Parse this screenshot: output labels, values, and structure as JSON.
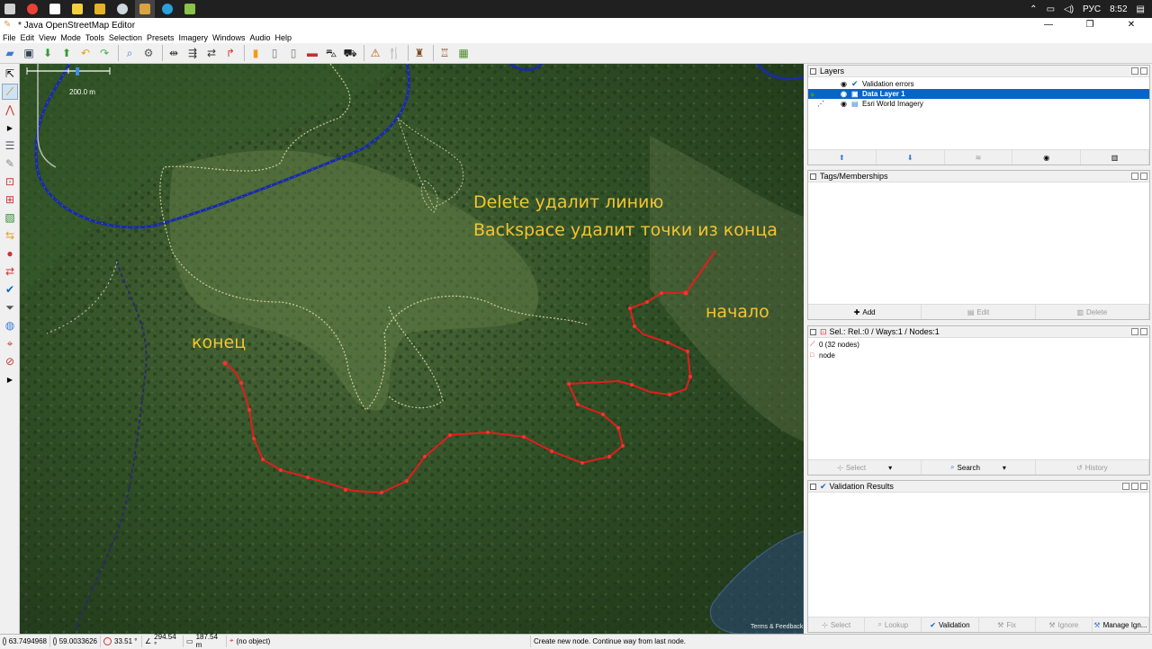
{
  "taskbar": {
    "apps": [
      {
        "icon": "task-view-icon",
        "color": "#e0e0e0"
      },
      {
        "icon": "chrome-icon",
        "color": "#e94235"
      },
      {
        "icon": "file-icon",
        "color": "#ffffff"
      },
      {
        "icon": "notes-icon",
        "color": "#f4d03f"
      },
      {
        "icon": "folder-icon",
        "color": "#e6b422"
      },
      {
        "icon": "steam-icon",
        "color": "#cfd8dc"
      },
      {
        "icon": "josm-icon",
        "color": "#d9a441"
      },
      {
        "icon": "telegram-icon",
        "color": "#2aa1da"
      },
      {
        "icon": "app-icon",
        "color": "#8bc34a"
      }
    ],
    "lang": "РУС",
    "time": "8:52"
  },
  "window": {
    "title": "* Java OpenStreetMap Editor"
  },
  "menu": [
    "File",
    "Edit",
    "View",
    "Mode",
    "Tools",
    "Selection",
    "Presets",
    "Imagery",
    "Windows",
    "Audio",
    "Help"
  ],
  "map": {
    "scale_label": "200.0 m",
    "annotation_delete": "Delete удалит линию",
    "annotation_backspace": "Backspace удалит точки из конца",
    "label_start": "начало",
    "label_end": "конец",
    "attribution": "Terms & Feedback"
  },
  "layers_panel": {
    "title": "Layers",
    "layers": [
      {
        "name": "Validation errors"
      },
      {
        "name": "Data Layer 1"
      },
      {
        "name": "Esri World Imagery"
      }
    ]
  },
  "tags_panel": {
    "title": "Tags/Memberships",
    "add": "Add",
    "edit": "Edit",
    "delete": "Delete"
  },
  "selection_panel": {
    "title": "Sel.: Rel.:0 / Ways:1 / Nodes:1",
    "items": [
      "0 (32 nodes)",
      "node"
    ],
    "select": "Select",
    "search": "Search",
    "history": "History"
  },
  "validation_panel": {
    "title": "Validation Results",
    "buttons": [
      "Select",
      "Lookup",
      "Validation",
      "Fix",
      "Ignore",
      "Manage Ign..."
    ]
  },
  "status": {
    "lat": "63.7494968",
    "lon": "59.0033626",
    "angle": "33.51 °",
    "heading": "294.54 °",
    "distance": "187.54 m",
    "object": "(no object)",
    "message": "Create new node. Continue way from last node."
  }
}
